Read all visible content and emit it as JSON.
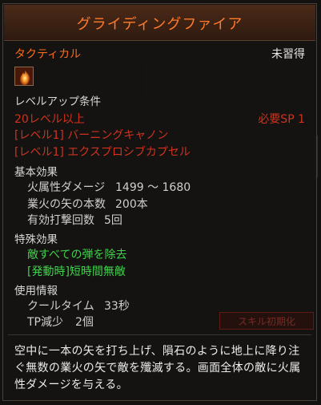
{
  "tooltip": {
    "title": "グライディングファイア",
    "category": "タクティカル",
    "status": "未習得",
    "icon": "fire-burst-icon"
  },
  "level_up": {
    "heading": "レベルアップ条件",
    "level_req": "20レベル以上",
    "sp_req": "必要SP 1",
    "prereqs": [
      "[レベル1] バーニングキャノン",
      "[レベル1] エクスプロシブカプセル"
    ]
  },
  "basic": {
    "heading": "基本効果",
    "rows": [
      {
        "label": "火属性ダメージ",
        "value": "1499 ～ 1680"
      },
      {
        "label": "業火の矢の本数",
        "value": "200本"
      },
      {
        "label": "有効打撃回数",
        "value": "5回"
      }
    ]
  },
  "special": {
    "heading": "特殊効果",
    "effects": [
      "敵すべての弾を除去",
      "[発動時]短時間無敵"
    ]
  },
  "usage": {
    "heading": "使用情報",
    "rows": [
      {
        "label": "クールタイム",
        "value": "33秒"
      },
      {
        "label": "TP減少",
        "value": "2個"
      }
    ]
  },
  "description": "空中に一本の矢を打ち上げ、隕石のように地上に降り注ぐ無数の業火の矢で敵を殲滅する。画面全体の敵に火属性ダメージを与える。",
  "background": {
    "reset_button": "スキル初期化"
  },
  "colors": {
    "title": "#ff7a2a",
    "category": "#ff6a1a",
    "requirement": "#d0321e",
    "special": "#3fd24a"
  }
}
